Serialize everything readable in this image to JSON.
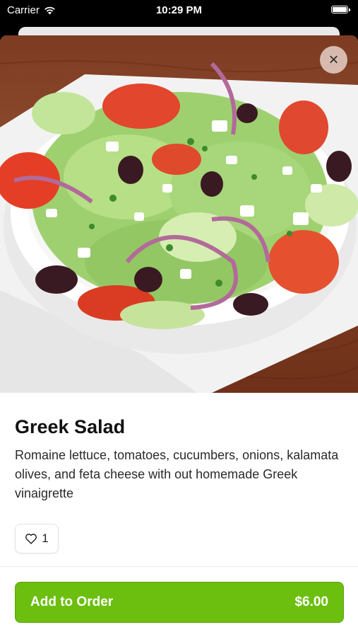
{
  "status_bar": {
    "carrier": "Carrier",
    "time": "10:29 PM",
    "icons": [
      "wifi-icon",
      "battery-icon"
    ]
  },
  "item": {
    "name": "Greek Salad",
    "description": "Romaine lettuce, tomatoes, cucumbers, onions, kalamata olives, and feta cheese with out homemade Greek vinaigrette",
    "image_alt": "Greek salad in a white bowl"
  },
  "actions": {
    "close_icon": "×",
    "like_count": "1",
    "add_to_order_label": "Add to Order",
    "price": "$6.00"
  },
  "colors": {
    "accent": "#6cbf0f",
    "table_wood": "#7d3b22"
  }
}
